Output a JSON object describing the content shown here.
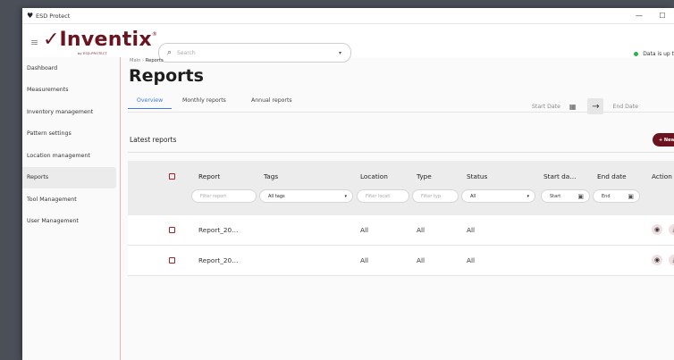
{
  "window": {
    "title": "ESD Protect",
    "controls": {
      "minimize": "—",
      "maximize": "☐"
    }
  },
  "header": {
    "logo_text": "Inventix",
    "logo_sub": "by ESD-PROTECT",
    "search_placeholder": "Search",
    "status_text": "Data is up t"
  },
  "sidebar": {
    "items": [
      {
        "label": "Dashboard",
        "active": false
      },
      {
        "label": "Measurements",
        "active": false
      },
      {
        "label": "Inventory management",
        "active": false
      },
      {
        "label": "Pattern settings",
        "active": false
      },
      {
        "label": "Location management",
        "active": false
      },
      {
        "label": "Reports",
        "active": true
      },
      {
        "label": "Tool Management",
        "active": false
      },
      {
        "label": "User Management",
        "active": false
      }
    ]
  },
  "main": {
    "breadcrumb_root": "Main",
    "breadcrumb_sep": " › ",
    "breadcrumb_current": "Reports",
    "title": "Reports",
    "tabs": [
      {
        "label": "Overview"
      },
      {
        "label": "Monthly reports"
      },
      {
        "label": "Annual reports"
      }
    ],
    "start_date_label": "Start Date",
    "end_date_label": "End Date",
    "section_title": "Latest reports",
    "new_report_label": "+ New Rep"
  },
  "table": {
    "headers": {
      "report": "Report",
      "tags": "Tags",
      "location": "Location",
      "type": "Type",
      "status": "Status",
      "start_date": "Start da…",
      "end_date": "End date",
      "action": "Action"
    },
    "filters": {
      "report": "Filter report",
      "tags": "All tags",
      "location": "Filter locati",
      "type": "Filter typ",
      "status": "All",
      "start": "Start",
      "end": "End"
    },
    "rows": [
      {
        "report": "Report_20…",
        "location": "All",
        "type": "All",
        "status": "All"
      },
      {
        "report": "Report_20…",
        "location": "All",
        "type": "All",
        "status": "All"
      }
    ]
  }
}
